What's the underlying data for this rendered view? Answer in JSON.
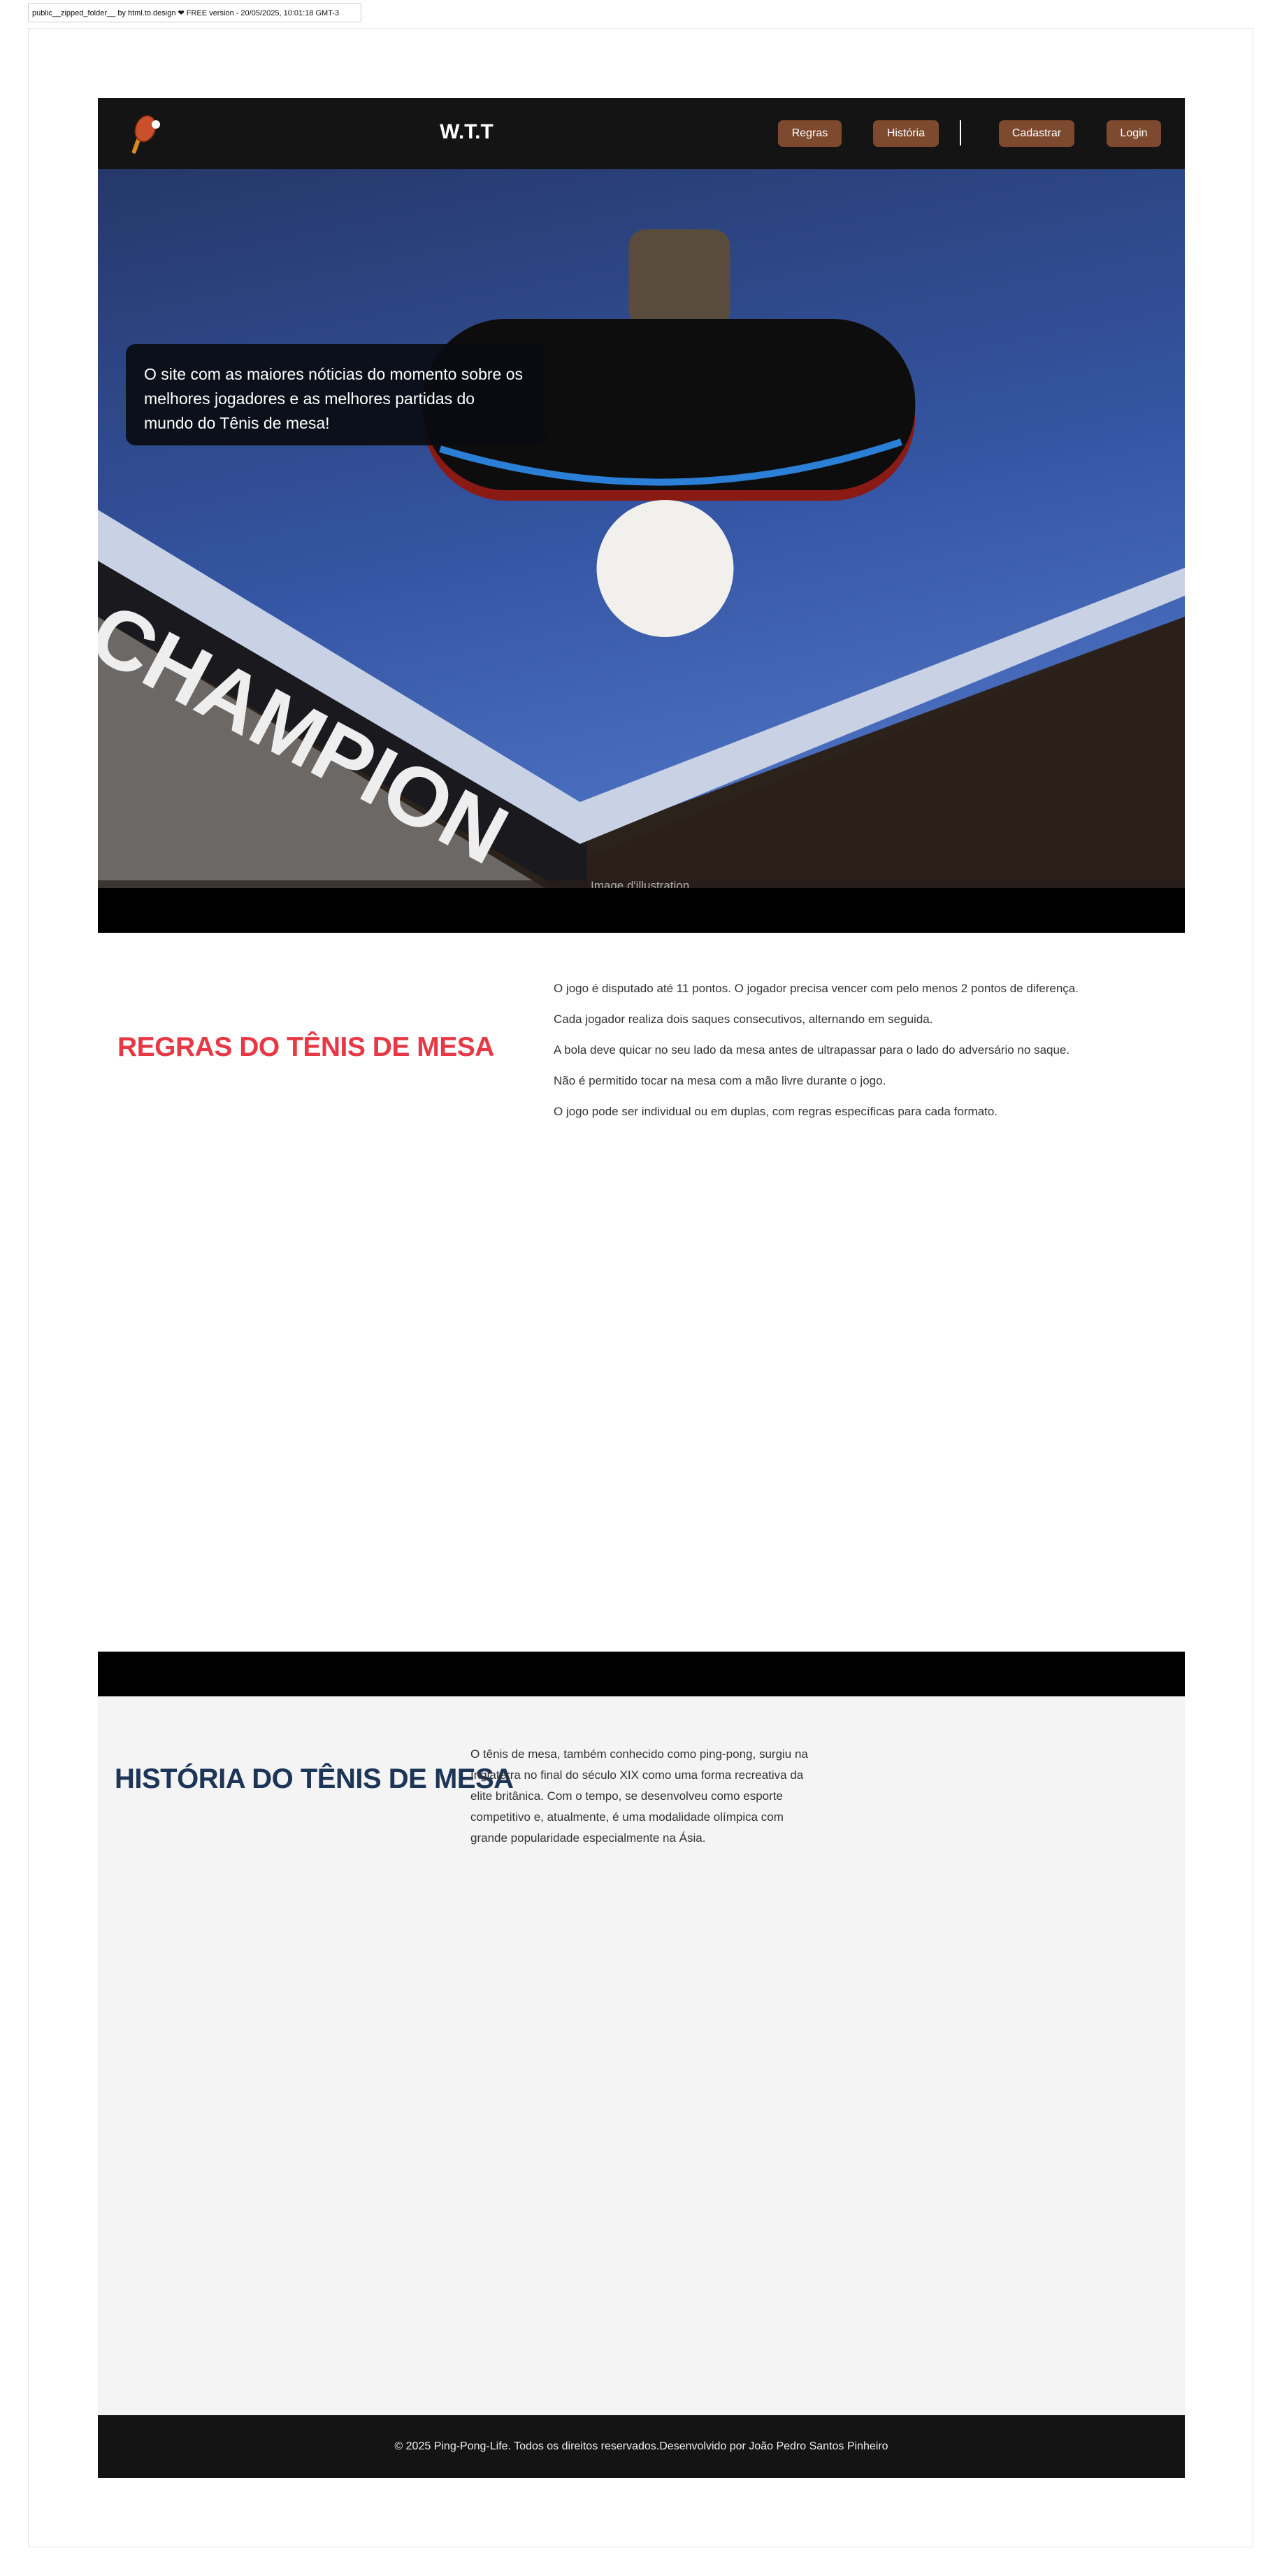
{
  "export_label": "public__zipped_folder__ by html.to.design ❤ FREE version - 20/05/2025, 10:01:18 GMT-3",
  "header": {
    "logo_icon": "ping-pong-paddle-icon",
    "title": "W.T.T",
    "nav": [
      {
        "label": "Regras"
      },
      {
        "label": "História"
      },
      {
        "label": "Cadastrar"
      },
      {
        "label": "Login"
      }
    ],
    "button_color": "#7d4a2f"
  },
  "hero": {
    "text": "O site com as maiores nóticias do momento sobre os melhores jogadores e as melhores partidas do mundo do Tênis de mesa!",
    "caption": "Image d'illustration",
    "image_brand_text": "CHAMPION"
  },
  "rules": {
    "title": "REGRAS DO TÊNIS DE MESA",
    "title_color": "#e63946",
    "items": [
      "O jogo é disputado até 11 pontos. O jogador precisa vencer com pelo menos 2 pontos de diferença.",
      "Cada jogador realiza dois saques consecutivos, alternando em seguida.",
      "A bola deve quicar no seu lado da mesa antes de ultrapassar para o lado do adversário no saque.",
      "Não é permitido tocar na mesa com a mão livre durante o jogo.",
      "O jogo pode ser individual ou em duplas, com regras específicas para cada formato."
    ]
  },
  "history": {
    "title": "HISTÓRIA DO TÊNIS DE MESA",
    "title_color": "#1d3557",
    "text": "O tênis de mesa, também conhecido como ping-pong, surgiu na Inglaterra no final do século XIX como uma forma recreativa da elite britânica. Com o tempo, se desenvolveu como esporte competitivo e, atualmente, é uma modalidade olímpica com grande popularidade especialmente na Ásia."
  },
  "footer": {
    "text": "© 2025 Ping-Pong-Life. Todos os direitos reservados.Desenvolvido por João Pedro Santos Pinheiro"
  }
}
